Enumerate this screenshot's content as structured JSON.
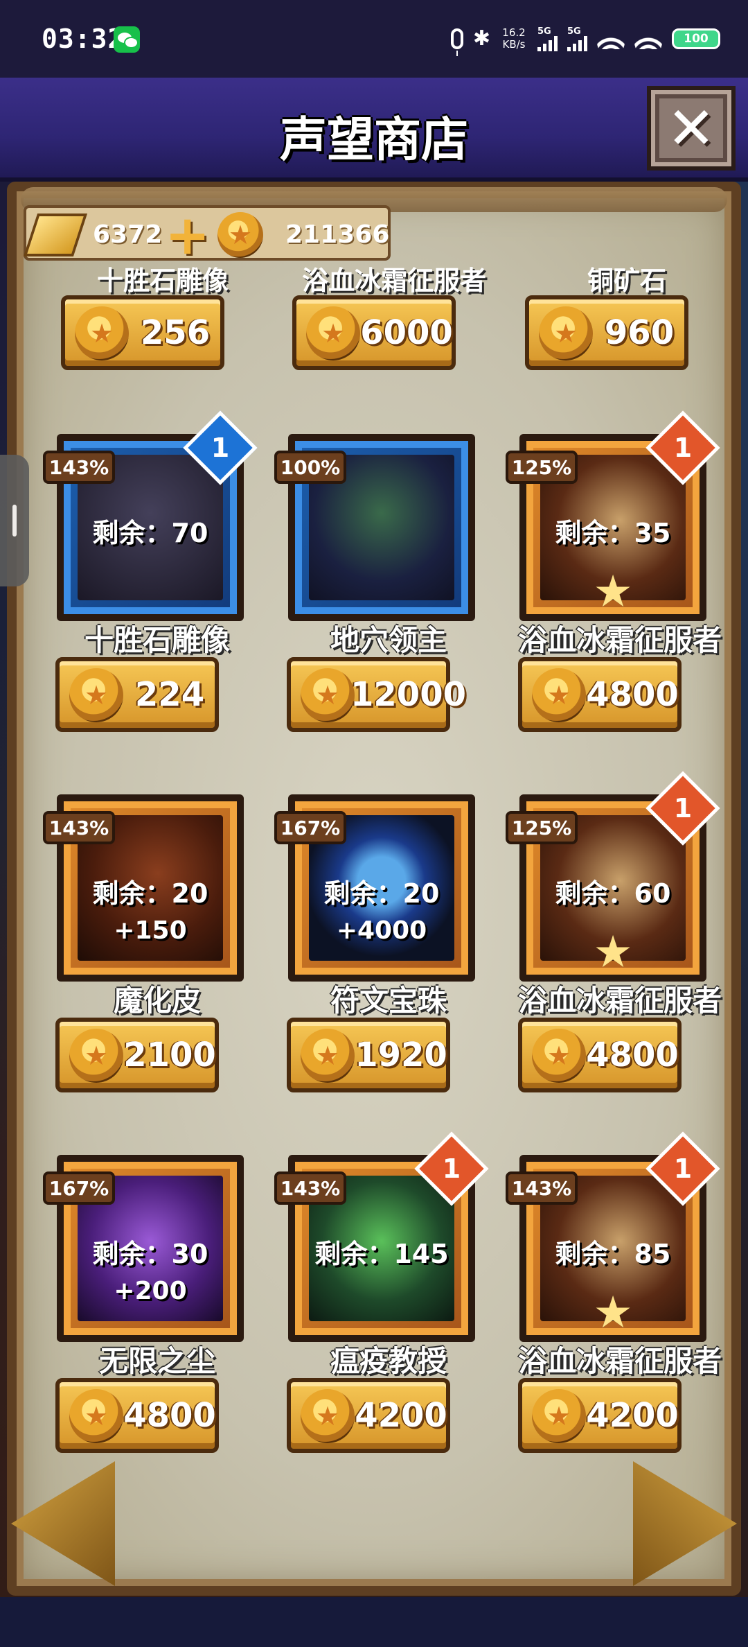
{
  "status_bar": {
    "time": "03:32",
    "net_speed_value": "16.2",
    "net_speed_unit": "KB/s",
    "sim1": "5G",
    "sim2": "5G",
    "battery": "100"
  },
  "header": {
    "title": "声望商店",
    "close_icon": "close-icon"
  },
  "currency": {
    "gold_amount": "6372",
    "coin_amount": "211366"
  },
  "partial_row": [
    {
      "name": "十胜石雕像",
      "price": "256"
    },
    {
      "name": "浴血冰霜征服者",
      "price": "6000"
    },
    {
      "name": "铜矿石",
      "price": "960"
    }
  ],
  "items": [
    {
      "name": "十胜石雕像",
      "bonus_pct": "143%",
      "remain": "剩余：70",
      "count": "1",
      "price": "224",
      "frame": "blue",
      "art": "statue"
    },
    {
      "name": "地穴领主",
      "bonus_pct": "100%",
      "remain": "",
      "count": "",
      "price": "12000",
      "frame": "blue",
      "art": "lord"
    },
    {
      "name": "浴血冰霜征服者",
      "bonus_pct": "125%",
      "remain": "剩余：35",
      "count": "1",
      "price": "4800",
      "frame": "orange",
      "art": "dragon"
    },
    {
      "name": "魔化皮",
      "bonus_pct": "143%",
      "remain": "剩余：20",
      "bonus": "+150",
      "count": "",
      "price": "2100",
      "frame": "orange",
      "art": "leather"
    },
    {
      "name": "符文宝珠",
      "bonus_pct": "167%",
      "remain": "剩余：20",
      "bonus": "+4000",
      "count": "",
      "price": "1920",
      "frame": "orange",
      "art": "orb"
    },
    {
      "name": "浴血冰霜征服者",
      "bonus_pct": "125%",
      "remain": "剩余：60",
      "count": "1",
      "price": "4800",
      "frame": "orange",
      "art": "dragon"
    },
    {
      "name": "无限之尘",
      "bonus_pct": "167%",
      "remain": "剩余：30",
      "bonus": "+200",
      "count": "",
      "price": "4800",
      "frame": "orange",
      "art": "dust"
    },
    {
      "name": "瘟疫教授",
      "bonus_pct": "143%",
      "remain": "剩余：145",
      "count": "1",
      "price": "4200",
      "frame": "orange",
      "art": "wizard"
    },
    {
      "name": "浴血冰霜征服者",
      "bonus_pct": "143%",
      "remain": "剩余：85",
      "count": "1",
      "price": "4200",
      "frame": "orange",
      "art": "dragon"
    }
  ]
}
